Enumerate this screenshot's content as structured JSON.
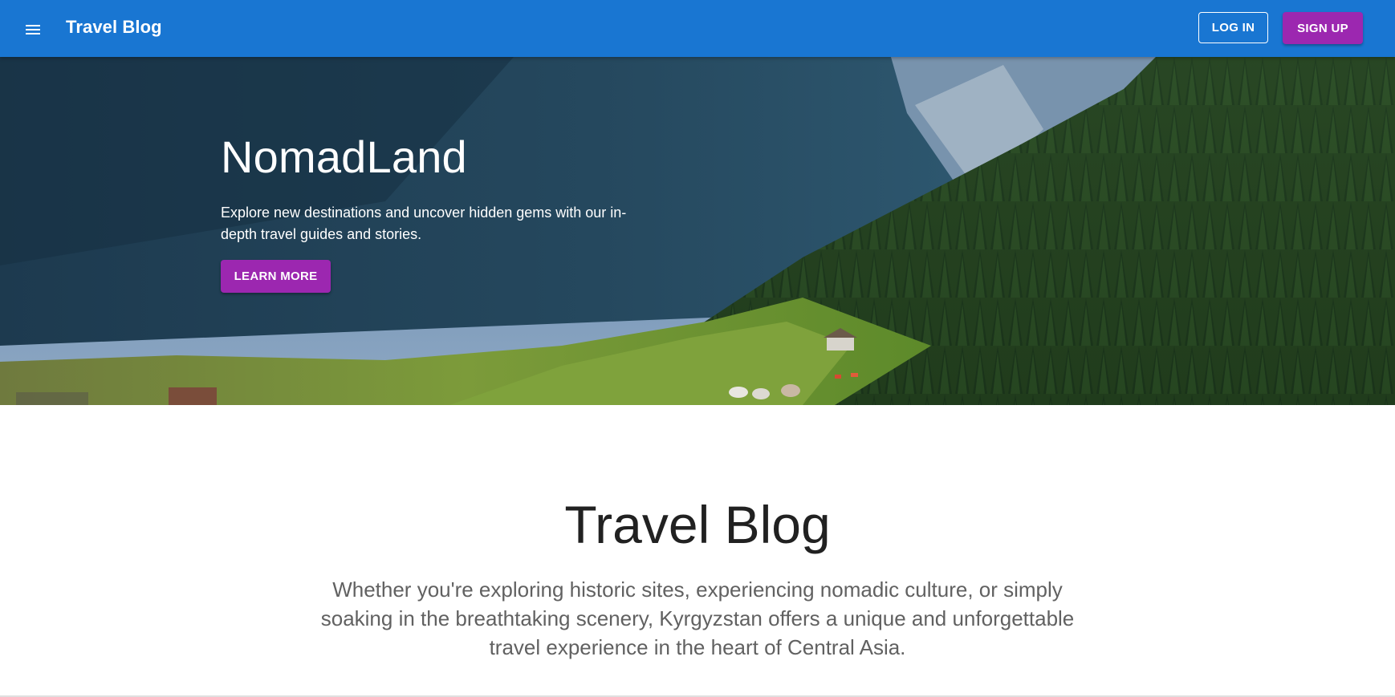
{
  "appbar": {
    "menu_icon": "hamburger-menu-icon",
    "title": "Travel Blog",
    "login_label": "LOG IN",
    "signup_label": "SIGN UP",
    "background_color": "#1976d2",
    "accent_color": "#9c27b0"
  },
  "hero": {
    "title": "NomadLand",
    "subtitle": "Explore new destinations and uncover hidden gems with our in-depth travel guides and stories.",
    "cta_label": "LEARN MORE",
    "image": "mountain-valley-forest-yurts-photo"
  },
  "intro": {
    "title": "Travel Blog",
    "text": "Whether you're exploring historic sites, experiencing nomadic culture, or simply soaking in the breathtaking scenery, Kyrgyzstan offers a unique and unforgettable travel experience in the heart of Central Asia."
  }
}
